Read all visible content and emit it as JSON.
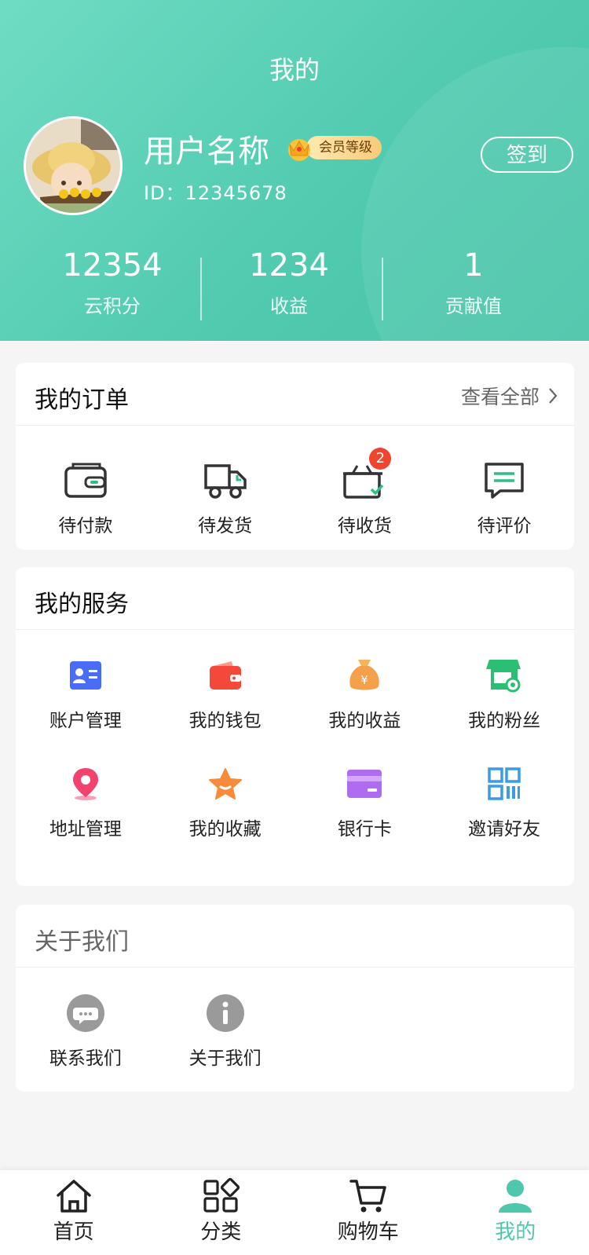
{
  "header": {
    "title": "我的",
    "username": "用户名称",
    "vip_label": "会员等级",
    "user_id": "ID：12345678",
    "signin_label": "签到",
    "stats": [
      {
        "value": "12354",
        "label": "云积分"
      },
      {
        "value": "1234",
        "label": "收益"
      },
      {
        "value": "1",
        "label": "贡献值"
      }
    ]
  },
  "orders": {
    "title": "我的订单",
    "view_all": "查看全部",
    "items": [
      {
        "label": "待付款",
        "icon": "wallet-icon"
      },
      {
        "label": "待发货",
        "icon": "truck-icon"
      },
      {
        "label": "待收货",
        "icon": "package-check-icon",
        "badge": "2"
      },
      {
        "label": "待评价",
        "icon": "message-icon"
      }
    ]
  },
  "services": {
    "title": "我的服务",
    "items": [
      {
        "label": "账户管理",
        "icon": "id-card-icon",
        "color": "#4a6cf7"
      },
      {
        "label": "我的钱包",
        "icon": "wallet-icon",
        "color": "#f4483b"
      },
      {
        "label": "我的收益",
        "icon": "money-bag-icon",
        "color": "#f5a04a"
      },
      {
        "label": "我的粉丝",
        "icon": "store-icon",
        "color": "#2bbf73"
      },
      {
        "label": "地址管理",
        "icon": "location-pin-icon",
        "color": "#f2436e"
      },
      {
        "label": "我的收藏",
        "icon": "star-icon",
        "color": "#f88a3b"
      },
      {
        "label": "银行卡",
        "icon": "bank-card-icon",
        "color": "#b06cf0"
      },
      {
        "label": "邀请好友",
        "icon": "qr-code-icon",
        "color": "#3a9be8"
      }
    ]
  },
  "about": {
    "title": "关于我们",
    "items": [
      {
        "label": "联系我们",
        "icon": "chat-icon"
      },
      {
        "label": "关于我们",
        "icon": "info-icon"
      }
    ]
  },
  "tabbar": {
    "items": [
      {
        "label": "首页",
        "icon": "home-icon"
      },
      {
        "label": "分类",
        "icon": "category-icon"
      },
      {
        "label": "购物车",
        "icon": "cart-icon"
      },
      {
        "label": "我的",
        "icon": "user-icon",
        "active": true
      }
    ],
    "active_color": "#4fc7ac"
  }
}
